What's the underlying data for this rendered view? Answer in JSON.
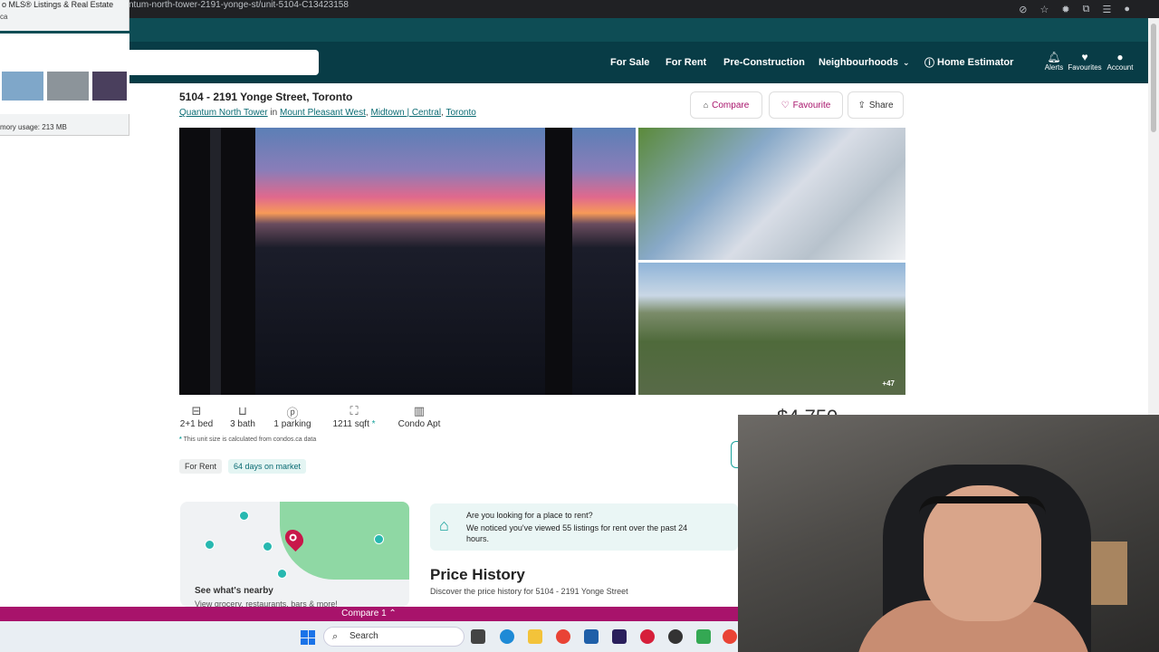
{
  "browser": {
    "url": "ntum-north-tower-2191-yonge-st/unit-5104-C13423158",
    "tab_popup": {
      "title": "o MLS® Listings & Real Estate",
      "domain": "ca",
      "memory": "mory usage: 213 MB"
    }
  },
  "nav": {
    "for_sale": "For Sale",
    "for_rent": "For Rent",
    "pre_construction": "Pre-Construction",
    "neighbourhoods": "Neighbourhoods",
    "home_estimator": "Home Estimator",
    "alerts": "Alerts",
    "favourites": "Favourites",
    "account": "Account"
  },
  "listing": {
    "address": "5104 - 2191 Yonge Street, Toronto",
    "building": "Quantum North Tower",
    "in": "in",
    "neighbourhood": "Mount Pleasant West",
    "region": "Midtown | Central",
    "city": "Toronto",
    "actions": {
      "compare": "Compare",
      "favourite": "Favourite",
      "share": "Share"
    },
    "photo_count": "+47",
    "stats": {
      "bed": "2+1 bed",
      "bath": "3 bath",
      "parking": "1 parking",
      "sqft": "1211 sqft",
      "sqft_mark": "*",
      "type": "Condo Apt"
    },
    "calc_note": "This unit size is calculated from condos.ca data",
    "calc_mark": "*",
    "tags": {
      "status": "For Rent",
      "days": "64 days on market"
    },
    "price_partial": "$4,750"
  },
  "map_card": {
    "title": "See what's nearby",
    "subtitle": "View grocery, restaurants, bars & more!"
  },
  "rent_prompt": {
    "question": "Are you looking for a place to rent?",
    "detail": "We noticed you've viewed 55 listings for rent over the past 24 hours."
  },
  "price_history": {
    "title": "Price History",
    "subtitle": "Discover the price history for 5104 - 2191 Yonge Street"
  },
  "compare_bar": {
    "label": "Compare 1"
  },
  "taskbar": {
    "search": "Search"
  },
  "colors": {
    "header": "#083c46",
    "accent": "#1aa39c",
    "compare_bar": "#a8136b",
    "link": "#0a6b73"
  }
}
